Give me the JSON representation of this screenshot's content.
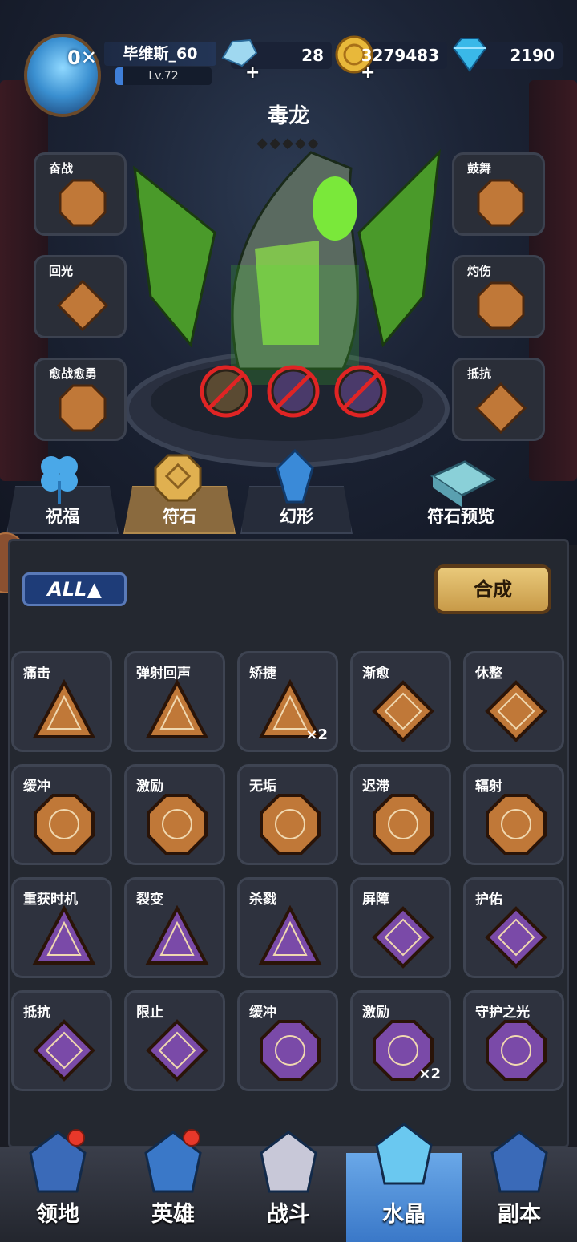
{
  "player": {
    "name": "毕维斯_60",
    "level": "Lv.72",
    "level_progress": 0.08
  },
  "resources": [
    {
      "name": "crystal-shard",
      "value": "28"
    },
    {
      "name": "gold",
      "value": "3279483"
    },
    {
      "name": "diamond",
      "value": "2190"
    }
  ],
  "creature": {
    "name": "毒龙",
    "stars": "◆◆◆◆◆"
  },
  "side_slots": {
    "left": [
      {
        "label": "奋战"
      },
      {
        "label": "回光"
      },
      {
        "label": "愈战愈勇"
      }
    ],
    "right": [
      {
        "label": "鼓舞"
      },
      {
        "label": "灼伤"
      },
      {
        "label": "抵抗"
      }
    ]
  },
  "tabs": [
    {
      "label": "祝福",
      "active": false
    },
    {
      "label": "符石",
      "active": true
    },
    {
      "label": "幻形",
      "active": false
    },
    {
      "label": "符石预览",
      "active": false
    }
  ],
  "filter": {
    "label": "ALL▲"
  },
  "synthesize": {
    "label": "合成"
  },
  "runes": [
    {
      "label": "痛击",
      "kind": "bronze-triangle",
      "count": ""
    },
    {
      "label": "弹射回声",
      "kind": "bronze-triangle",
      "count": ""
    },
    {
      "label": "矫捷",
      "kind": "bronze-triangle",
      "count": "×2"
    },
    {
      "label": "渐愈",
      "kind": "bronze-diamond",
      "count": ""
    },
    {
      "label": "休整",
      "kind": "bronze-diamond",
      "count": ""
    },
    {
      "label": "缓冲",
      "kind": "bronze-octagon",
      "count": ""
    },
    {
      "label": "激励",
      "kind": "bronze-octagon",
      "count": ""
    },
    {
      "label": "无垢",
      "kind": "bronze-octagon",
      "count": ""
    },
    {
      "label": "迟滞",
      "kind": "bronze-octagon",
      "count": ""
    },
    {
      "label": "辐射",
      "kind": "bronze-octagon",
      "count": ""
    },
    {
      "label": "重获时机",
      "kind": "purple-triangle",
      "count": ""
    },
    {
      "label": "裂变",
      "kind": "purple-triangle",
      "count": ""
    },
    {
      "label": "杀戮",
      "kind": "purple-triangle",
      "count": ""
    },
    {
      "label": "屏障",
      "kind": "purple-diamond",
      "count": ""
    },
    {
      "label": "护佑",
      "kind": "purple-diamond",
      "count": ""
    },
    {
      "label": "抵抗",
      "kind": "purple-diamond",
      "count": ""
    },
    {
      "label": "限止",
      "kind": "purple-diamond",
      "count": ""
    },
    {
      "label": "缓冲",
      "kind": "purple-octagon",
      "count": ""
    },
    {
      "label": "激励",
      "kind": "purple-octagon",
      "count": "×2"
    },
    {
      "label": "守护之光",
      "kind": "purple-octagon",
      "count": ""
    }
  ],
  "nav": [
    {
      "label": "领地",
      "active": false,
      "badge": true
    },
    {
      "label": "英雄",
      "active": false,
      "badge": true
    },
    {
      "label": "战斗",
      "active": false,
      "badge": false
    },
    {
      "label": "水晶",
      "active": true,
      "badge": false
    },
    {
      "label": "副本",
      "active": false,
      "badge": false
    }
  ],
  "colors": {
    "bronze": "#c07838",
    "purple": "#7a4aa8",
    "accent_gold": "#d9b060",
    "active_blue": "#4a8ad8"
  }
}
